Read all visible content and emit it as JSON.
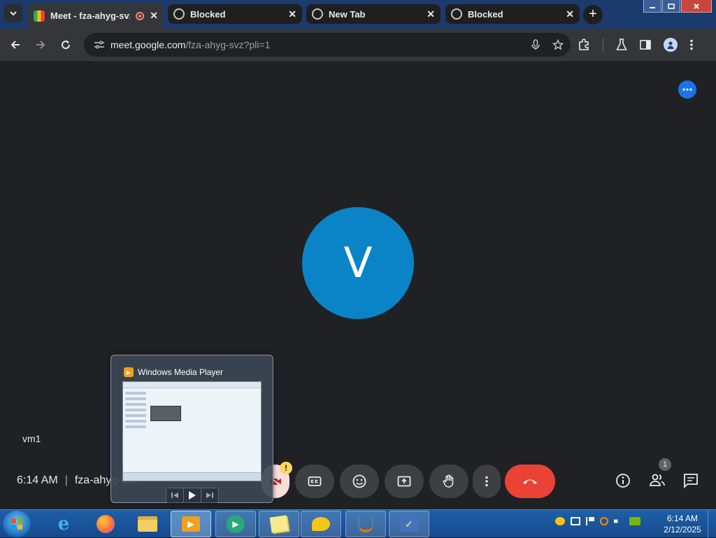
{
  "browser": {
    "tabs": [
      {
        "title": "Meet - fza-ahyg-svz",
        "active": true,
        "recording": true
      },
      {
        "title": "Blocked",
        "active": false
      },
      {
        "title": "New Tab",
        "active": false
      },
      {
        "title": "Blocked",
        "active": false
      }
    ],
    "close_glyph": "✕",
    "new_tab_glyph": "+",
    "url_host": "meet.google.com",
    "url_path": "/fza-ahyg-svz?pli=1"
  },
  "meet": {
    "avatar_letter": "V",
    "participant_name": "vm1",
    "time": "6:14 AM",
    "meeting_code": "fza-ahyg-svz",
    "people_count": "1",
    "warning_glyph": "!"
  },
  "popup": {
    "title": "Windows Media Player"
  },
  "taskbar": {
    "clock_time": "6:14 AM",
    "clock_date": "2/12/2025"
  },
  "colors": {
    "meet_bg": "#202124",
    "avatar_bg": "#0a84c6",
    "end_call": "#ea4335",
    "accent_blue": "#1a73e8",
    "tabstrip": "#1b3b6e",
    "taskbar": "#1e5fa8"
  }
}
